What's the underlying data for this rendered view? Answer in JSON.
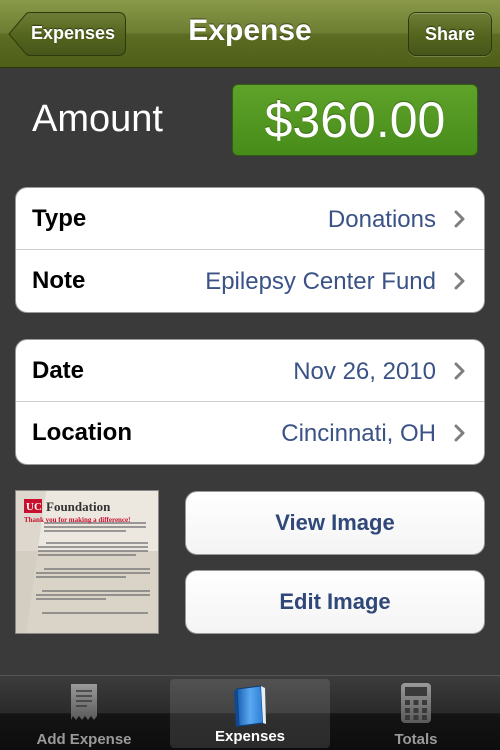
{
  "navbar": {
    "back_label": "Expenses",
    "title": "Expense",
    "share_label": "Share"
  },
  "amount": {
    "label": "Amount",
    "value": "$360.00"
  },
  "group1": [
    {
      "key": "Type",
      "value": "Donations"
    },
    {
      "key": "Note",
      "value": "Epilepsy Center Fund"
    }
  ],
  "group2": [
    {
      "key": "Date",
      "value": "Nov 26, 2010"
    },
    {
      "key": "Location",
      "value": "Cincinnati, OH"
    }
  ],
  "receipt": {
    "thumbnail_brand": "Foundation",
    "thumbnail_heading": "Thank you for making a difference!"
  },
  "image_buttons": {
    "view": "View Image",
    "edit": "Edit Image"
  },
  "tabbar": {
    "tabs": [
      {
        "label": "Add Expense",
        "icon": "receipt-icon"
      },
      {
        "label": "Expenses",
        "icon": "book-icon",
        "selected": true
      },
      {
        "label": "Totals",
        "icon": "calculator-icon"
      }
    ]
  },
  "colors": {
    "navbar": "#6e7e32",
    "amount_green": "#4f961f",
    "value_blue": "#3a5286",
    "background": "#3a3a3a"
  }
}
